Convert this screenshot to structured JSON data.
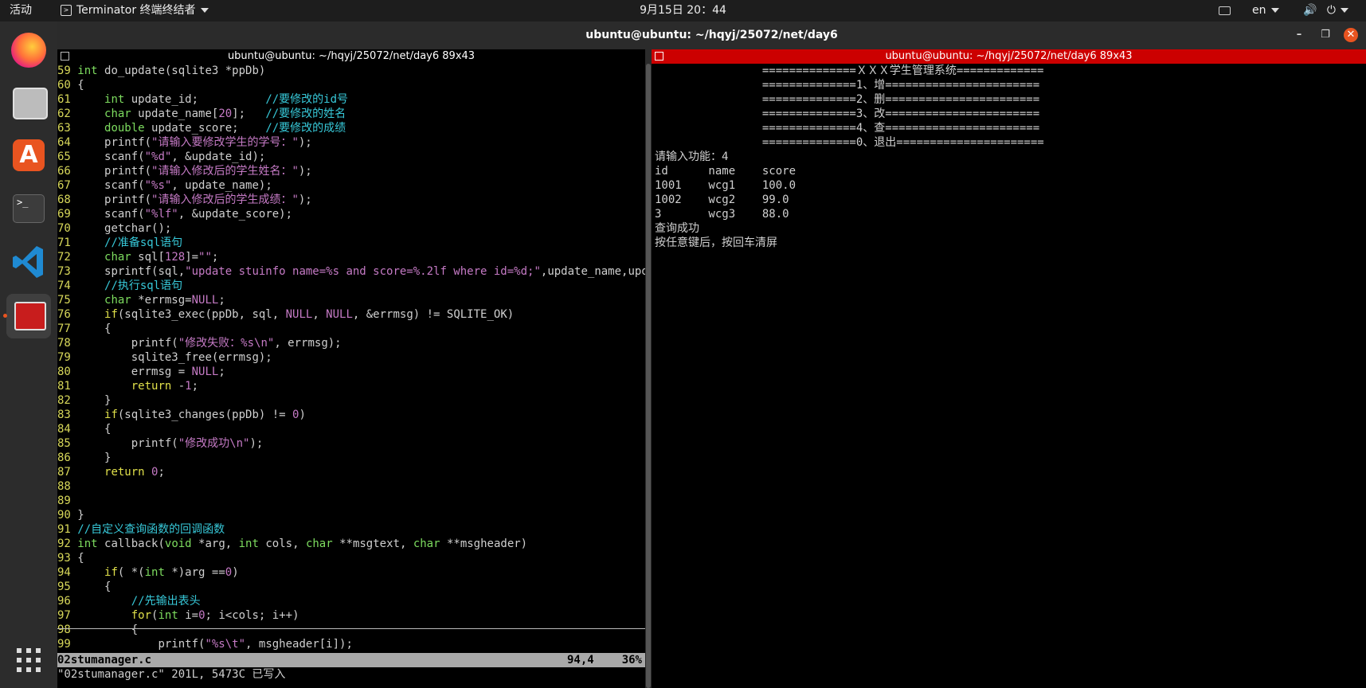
{
  "topbar": {
    "activities": "活动",
    "app_name": "Terminator 终端终结者",
    "clock": "9月15日  20：44",
    "lang": "en"
  },
  "window": {
    "title": "ubuntu@ubuntu: ~/hqyj/25072/net/day6",
    "left_pane_title": "ubuntu@ubuntu: ~/hqyj/25072/net/day6 89x43",
    "right_pane_title": "ubuntu@ubuntu: ~/hqyj/25072/net/day6 89x43"
  },
  "dock": {
    "items": [
      "firefox-icon",
      "files-icon",
      "app-center-icon",
      "terminal-icon",
      "vscode-icon",
      "terminator-icon"
    ],
    "apps_grid": "show-apps-icon"
  },
  "colors": {
    "active_pane_header": "#cc0000",
    "inactive_pane_header": "#000000",
    "statusline_bg": "#a9a9a9"
  },
  "editor": {
    "lines": [
      {
        "n": "59",
        "t": "int do_update(sqlite3 *ppDb)"
      },
      {
        "n": "60",
        "t": "{"
      },
      {
        "n": "61",
        "t": "    int update_id;          //要修改的id号"
      },
      {
        "n": "62",
        "t": "    char update_name[20];   //要修改的姓名"
      },
      {
        "n": "63",
        "t": "    double update_score;    //要修改的成绩"
      },
      {
        "n": "64",
        "t": "    printf(\"请输入要修改学生的学号：\");"
      },
      {
        "n": "65",
        "t": "    scanf(\"%d\", &update_id);"
      },
      {
        "n": "66",
        "t": "    printf(\"请输入修改后的学生姓名：\");"
      },
      {
        "n": "67",
        "t": "    scanf(\"%s\", update_name);"
      },
      {
        "n": "68",
        "t": "    printf(\"请输入修改后的学生成绩：\");"
      },
      {
        "n": "69",
        "t": "    scanf(\"%lf\", &update_score);"
      },
      {
        "n": "70",
        "t": "    getchar();"
      },
      {
        "n": "71",
        "t": "    //准备sql语句"
      },
      {
        "n": "72",
        "t": "    char sql[128]=\"\";"
      },
      {
        "n": "73",
        "t": "    sprintf(sql,\"update stuinfo name=%s and score=%.2lf where id=%d;\",update_name,upd"
      },
      {
        "n": "74",
        "t": "    //执行sql语句"
      },
      {
        "n": "75",
        "t": "    char *errmsg=NULL;"
      },
      {
        "n": "76",
        "t": "    if(sqlite3_exec(ppDb, sql, NULL, NULL, &errmsg) != SQLITE_OK)"
      },
      {
        "n": "77",
        "t": "    {"
      },
      {
        "n": "78",
        "t": "        printf(\"修改失败：%s\\n\", errmsg);"
      },
      {
        "n": "79",
        "t": "        sqlite3_free(errmsg);"
      },
      {
        "n": "80",
        "t": "        errmsg = NULL;"
      },
      {
        "n": "81",
        "t": "        return -1;"
      },
      {
        "n": "82",
        "t": "    }"
      },
      {
        "n": "83",
        "t": "    if(sqlite3_changes(ppDb) != 0)"
      },
      {
        "n": "84",
        "t": "    {"
      },
      {
        "n": "85",
        "t": "        printf(\"修改成功\\n\");"
      },
      {
        "n": "86",
        "t": "    }"
      },
      {
        "n": "87",
        "t": "    return 0;"
      },
      {
        "n": "88",
        "t": ""
      },
      {
        "n": "89",
        "t": ""
      },
      {
        "n": "90",
        "t": "}"
      },
      {
        "n": "91",
        "t": "//自定义查询函数的回调函数"
      },
      {
        "n": "92",
        "t": "int callback(void *arg, int cols, char **msgtext, char **msgheader)"
      },
      {
        "n": "93",
        "t": "{"
      },
      {
        "n": "94",
        "t": "    if( *(int *)arg ==0)"
      },
      {
        "n": "95",
        "t": "    {"
      },
      {
        "n": "96",
        "t": "        //先输出表头"
      },
      {
        "n": "97",
        "t": "        for(int i=0; i<cols; i++)"
      },
      {
        "n": "98",
        "t": "        {"
      },
      {
        "n": "99",
        "t": "            printf(\"%s\\t\", msgheader[i]);"
      }
    ],
    "status_file": "02stumanager.c",
    "status_pos": "94,4",
    "status_pct": "36%",
    "cmdline": "\"02stumanager.c\" 201L, 5473C 已写入"
  },
  "terminal": {
    "lines": [
      "                ==============ＸＸＸ学生管理系统=============",
      "                ==============1、增=======================",
      "                ==============2、删=======================",
      "                ==============3、改=======================",
      "                ==============4、查=======================",
      "                ==============0、退出======================",
      "请输入功能：4",
      "id      name    score",
      "1001    wcg1    100.0",
      "1002    wcg2    99.0",
      "3       wcg3    88.0",
      "查询成功",
      "按任意键后，按回车清屏"
    ]
  }
}
